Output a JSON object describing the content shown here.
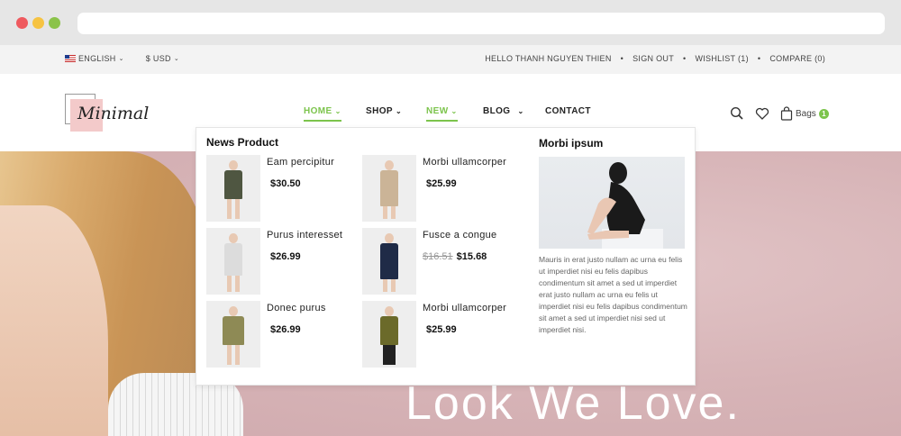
{
  "topbar": {
    "language": "ENGLISH",
    "currency": "$ USD",
    "greeting": "HELLO THANH NGUYEN THIEN",
    "sign_out": "SIGN OUT",
    "wishlist": "WISHLIST (1)",
    "compare": "COMPARE (0)",
    "separator": "•"
  },
  "logo": {
    "text": "Minimal"
  },
  "nav": {
    "home": "HOME",
    "shop": "SHOP",
    "new": "NEW",
    "blog": "BLOG",
    "contact": "CONTACT",
    "active_color": "#7cc44c"
  },
  "header_icons": {
    "search": "search-icon",
    "wishlist": "heart-icon",
    "bag": "bag-icon",
    "bags_label": "Bags",
    "bags_count": "1"
  },
  "mega_menu": {
    "news_title": "News Product",
    "feature_title": "Morbi ipsum",
    "products": [
      {
        "name": "Eam percipitur",
        "price": "$30.50",
        "old_price": "",
        "color": "#4f5641"
      },
      {
        "name": "Morbi ullamcorper",
        "price": "$25.99",
        "old_price": "",
        "color": "#cbb497"
      },
      {
        "name": "Purus interesset",
        "price": "$26.99",
        "old_price": "",
        "color": "#dcdcdc"
      },
      {
        "name": "Fusce a congue",
        "price": "$15.68",
        "old_price": "$16.51",
        "color": "#1f2b47"
      },
      {
        "name": "Donec purus",
        "price": "$26.99",
        "old_price": "",
        "color": "#8e8a55"
      },
      {
        "name": "Morbi ullamcorper",
        "price": "$25.99",
        "old_price": "",
        "color": "#6b6a2a"
      }
    ],
    "feature_text": "Mauris in erat justo nullam ac urna eu felis ut imperdiet nisi eu felis dapibus condimentum sit amet a sed ut imperdiet erat justo nullam ac urna eu felis ut imperdiet nisi eu felis dapibus condimentum sit amet a sed ut imperdiet nisi sed ut imperdiet nisi."
  },
  "hero": {
    "title": "Look We Love."
  }
}
